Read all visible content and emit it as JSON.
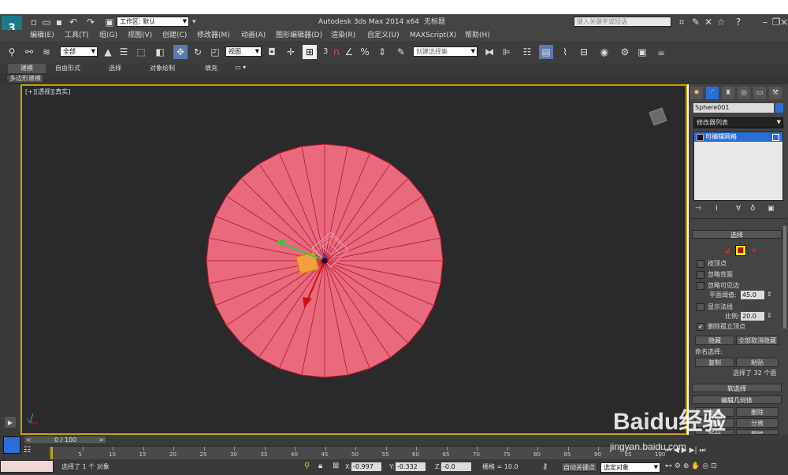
{
  "titlebar": {
    "workspace_label": "工作区: 默认",
    "app_title": "Autodesk 3ds Max  2014 x64",
    "doc_title": "无标题",
    "search_placeholder": "键入关键字或短语"
  },
  "menu": [
    "编辑(E)",
    "工具(T)",
    "组(G)",
    "视图(V)",
    "创建(C)",
    "修改器(M)",
    "动画(A)",
    "图形编辑器(D)",
    "渲染(R)",
    "自定义(U)",
    "MAXScript(X)",
    "帮助(H)"
  ],
  "toolbar": {
    "selection_filter": "全部",
    "ref_coord": "视图",
    "snap_label": "3",
    "named_selection_placeholder": "创建选择集"
  },
  "ribbon": {
    "tabs": [
      "建模",
      "自由形式",
      "选择",
      "对象绘制",
      "填充"
    ],
    "sub_label": "多边形建模"
  },
  "viewport": {
    "label": "[+][透视][真实]"
  },
  "command_panel": {
    "object_name": "Sphere001",
    "modifier_list": "修改器列表",
    "stack_item": "可编辑网格",
    "selection_title": "选择",
    "checkboxes": [
      {
        "label": "按顶点",
        "checked": false
      },
      {
        "label": "忽略背面",
        "checked": false
      },
      {
        "label": "忽略可见边",
        "checked": false
      }
    ],
    "planar_threshold_label": "平面阈值:",
    "planar_threshold_value": "45.0",
    "show_normals_label": "显示法线",
    "scale_label": "比例:",
    "scale_value": "20.0",
    "delete_isolated_label": "删除孤立顶点",
    "hide_button": "隐藏",
    "unhide_all_button": "全部取消隐藏",
    "named_selections_label": "命名选择:",
    "copy_button": "复制",
    "paste_button": "粘贴",
    "selected_status": "选择了 32 个面",
    "soft_selection_title": "软选择",
    "edit_geometry_title": "编辑几何体",
    "create_button": "创建",
    "delete_button": "删除",
    "attach_button": "附加",
    "detach_button": "分离",
    "split_button": "拆分",
    "flip_button": "翻转"
  },
  "timeline": {
    "frame_display": "0 / 100",
    "ticks": [
      "0",
      "5",
      "10",
      "15",
      "20",
      "25",
      "30",
      "35",
      "40",
      "45",
      "50",
      "55",
      "60",
      "65",
      "70",
      "75",
      "80",
      "85",
      "90",
      "95",
      "100"
    ]
  },
  "status": {
    "selection_text": "选择了 1 个 对象",
    "x_label": "X:",
    "x_value": "-0.997",
    "y_label": "Y:",
    "y_value": "-0.332",
    "z_label": "Z:",
    "z_value": "-0.0",
    "grid_text": "栅格 = 10.0",
    "auto_key": "自动关键点",
    "selected_object": "选定对象"
  },
  "watermark": {
    "brand": "Baidu经验",
    "url": "jingyan.baidu.com"
  },
  "colors": {
    "disk_fill": "#e86a7c",
    "disk_lines": "#b3142b",
    "viewport_border": "#c8a000",
    "highlight": "#2a6ed6"
  }
}
